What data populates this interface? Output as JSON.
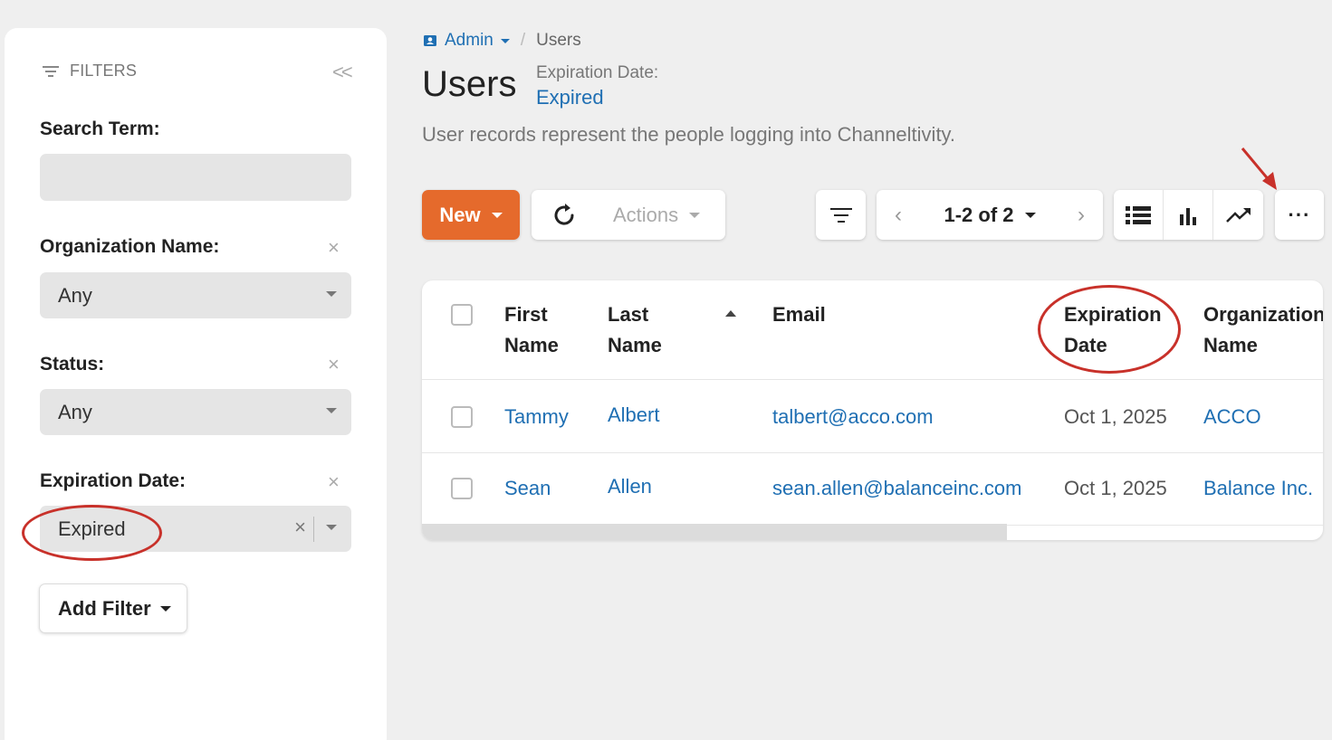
{
  "sidebar": {
    "title": "FILTERS",
    "collapse_glyph": "<<",
    "search": {
      "label": "Search Term:",
      "value": "",
      "placeholder": ""
    },
    "organization": {
      "label": "Organization Name:",
      "value": "Any"
    },
    "status": {
      "label": "Status:",
      "value": "Any"
    },
    "expiration": {
      "label": "Expiration Date:",
      "value": "Expired"
    },
    "clear_glyph": "×",
    "add_filter_label": "Add Filter"
  },
  "breadcrumb": {
    "parent": "Admin",
    "separator": "/",
    "current": "Users"
  },
  "page": {
    "title": "Users",
    "active_filter_label": "Expiration Date:",
    "active_filter_value": "Expired",
    "description": "User records represent the people logging into Channeltivity."
  },
  "toolbar": {
    "new_label": "New",
    "actions_label": "Actions",
    "pager_label": "1-2 of 2",
    "prev_glyph": "‹",
    "next_glyph": "›",
    "more_glyph": "···"
  },
  "table": {
    "columns": [
      {
        "line1": "First",
        "line2": "Name"
      },
      {
        "line1": "Last",
        "line2": "Name"
      },
      {
        "line1": "Email",
        "line2": ""
      },
      {
        "line1": "Expiration",
        "line2": "Date"
      },
      {
        "line1": "Organization",
        "line2": "Name"
      }
    ],
    "rows": [
      {
        "first": "Tammy",
        "last": "Albert",
        "email": "talbert@acco.com",
        "expiration": "Oct 1, 2025",
        "organization": "ACCO"
      },
      {
        "first": "Sean",
        "last": "Allen",
        "email": "sean.allen@balanceinc.com",
        "expiration": "Oct 1, 2025",
        "organization": "Balance Inc."
      }
    ]
  },
  "colors": {
    "accent": "#e56a2c",
    "link": "#1f6fb3",
    "annotation": "#c8312a"
  }
}
